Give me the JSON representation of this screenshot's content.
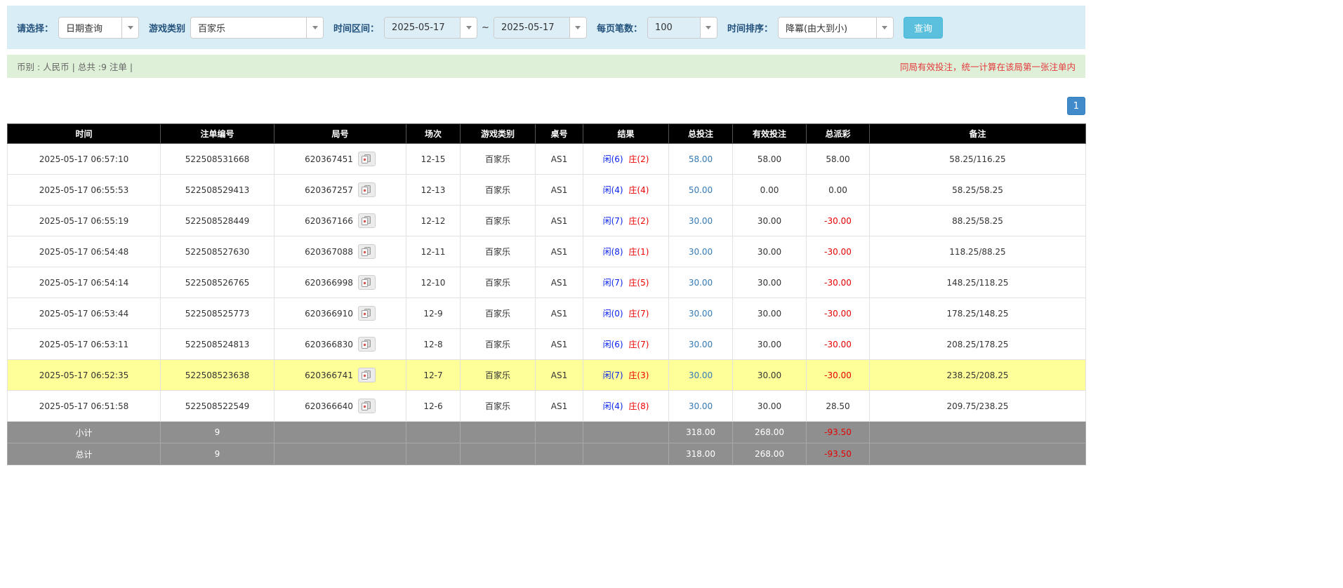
{
  "filter": {
    "select_label": "请选择：",
    "query_type": "日期查询",
    "game_label": "游戏类别",
    "game_type": "百家乐",
    "range_label": "时间区间：",
    "date_from": "2025-05-17",
    "range_separator": "~",
    "date_to": "2025-05-17",
    "page_size_label": "每页笔数：",
    "page_size": "100",
    "sort_label": "时间排序：",
    "sort_order": "降冪(由大到小)",
    "search_button": "查询"
  },
  "info_bar": {
    "summary": "币别 : 人民币 | 总共 :9 注单 |",
    "notice": "同局有效投注，统一计算在该局第一张注单内"
  },
  "pagination": {
    "current_page": "1"
  },
  "table": {
    "headers": [
      "时间",
      "注单编号",
      "局号",
      "场次",
      "游戏类别",
      "桌号",
      "结果",
      "总投注",
      "有效投注",
      "总派彩",
      "备注"
    ],
    "rows": [
      {
        "time": "2025-05-17 06:57:10",
        "bet_id": "522508531668",
        "round": "620367451",
        "session": "12-15",
        "game": "百家乐",
        "table_no": "AS1",
        "player": "闲(6)",
        "banker": "庄(2)",
        "total_bet": "58.00",
        "valid_bet": "58.00",
        "payout": "58.00",
        "note": "58.25/116.25",
        "highlight": false
      },
      {
        "time": "2025-05-17 06:55:53",
        "bet_id": "522508529413",
        "round": "620367257",
        "session": "12-13",
        "game": "百家乐",
        "table_no": "AS1",
        "player": "闲(4)",
        "banker": "庄(4)",
        "total_bet": "50.00",
        "valid_bet": "0.00",
        "payout": "0.00",
        "note": "58.25/58.25",
        "highlight": false
      },
      {
        "time": "2025-05-17 06:55:19",
        "bet_id": "522508528449",
        "round": "620367166",
        "session": "12-12",
        "game": "百家乐",
        "table_no": "AS1",
        "player": "闲(7)",
        "banker": "庄(2)",
        "total_bet": "30.00",
        "valid_bet": "30.00",
        "payout": "-30.00",
        "note": "88.25/58.25",
        "highlight": false
      },
      {
        "time": "2025-05-17 06:54:48",
        "bet_id": "522508527630",
        "round": "620367088",
        "session": "12-11",
        "game": "百家乐",
        "table_no": "AS1",
        "player": "闲(8)",
        "banker": "庄(1)",
        "total_bet": "30.00",
        "valid_bet": "30.00",
        "payout": "-30.00",
        "note": "118.25/88.25",
        "highlight": false
      },
      {
        "time": "2025-05-17 06:54:14",
        "bet_id": "522508526765",
        "round": "620366998",
        "session": "12-10",
        "game": "百家乐",
        "table_no": "AS1",
        "player": "闲(7)",
        "banker": "庄(5)",
        "total_bet": "30.00",
        "valid_bet": "30.00",
        "payout": "-30.00",
        "note": "148.25/118.25",
        "highlight": false
      },
      {
        "time": "2025-05-17 06:53:44",
        "bet_id": "522508525773",
        "round": "620366910",
        "session": "12-9",
        "game": "百家乐",
        "table_no": "AS1",
        "player": "闲(0)",
        "banker": "庄(7)",
        "total_bet": "30.00",
        "valid_bet": "30.00",
        "payout": "-30.00",
        "note": "178.25/148.25",
        "highlight": false
      },
      {
        "time": "2025-05-17 06:53:11",
        "bet_id": "522508524813",
        "round": "620366830",
        "session": "12-8",
        "game": "百家乐",
        "table_no": "AS1",
        "player": "闲(6)",
        "banker": "庄(7)",
        "total_bet": "30.00",
        "valid_bet": "30.00",
        "payout": "-30.00",
        "note": "208.25/178.25",
        "highlight": false
      },
      {
        "time": "2025-05-17 06:52:35",
        "bet_id": "522508523638",
        "round": "620366741",
        "session": "12-7",
        "game": "百家乐",
        "table_no": "AS1",
        "player": "闲(7)",
        "banker": "庄(3)",
        "total_bet": "30.00",
        "valid_bet": "30.00",
        "payout": "-30.00",
        "note": "238.25/208.25",
        "highlight": true
      },
      {
        "time": "2025-05-17 06:51:58",
        "bet_id": "522508522549",
        "round": "620366640",
        "session": "12-6",
        "game": "百家乐",
        "table_no": "AS1",
        "player": "闲(4)",
        "banker": "庄(8)",
        "total_bet": "30.00",
        "valid_bet": "30.00",
        "payout": "28.50",
        "note": "209.75/238.25",
        "highlight": false
      }
    ],
    "subtotal": {
      "label": "小计",
      "count": "9",
      "total_bet": "318.00",
      "valid_bet": "268.00",
      "payout": "-93.50"
    },
    "grand_total": {
      "label": "总计",
      "count": "9",
      "total_bet": "318.00",
      "valid_bet": "268.00",
      "payout": "-93.50"
    }
  },
  "colors": {
    "filter_bg": "#d9edf7",
    "info_bg": "#dff0d8",
    "info_text": "#666666",
    "notice_red": "#e4393c",
    "label_blue": "#23527c",
    "button_cyan": "#5bc0de",
    "accent_blue": "#428bca",
    "header_bg": "#000000",
    "highlight_yellow": "#ffff99",
    "summary_bg": "#8f8f8f",
    "player_blue": "#0b24ee",
    "banker_red": "#ee0000",
    "amount_blue": "#337ab7",
    "negative_red": "#e60000"
  }
}
